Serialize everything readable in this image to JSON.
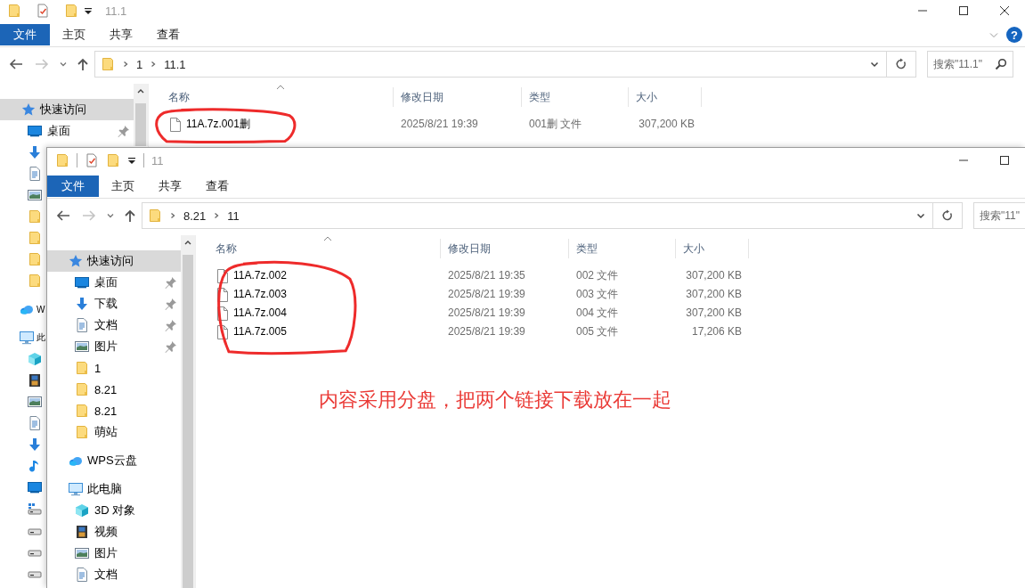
{
  "back_window": {
    "title": "11.1",
    "toolbar_separators": false,
    "ribbon": {
      "tabs": [
        {
          "label": "文件",
          "kind": "file"
        },
        {
          "label": "主页",
          "kind": "tab"
        },
        {
          "label": "共享",
          "kind": "tab"
        },
        {
          "label": "查看",
          "kind": "tab"
        }
      ],
      "help": "?"
    },
    "nav": {
      "back_disabled": false,
      "forward_disabled": true
    },
    "address": {
      "path": [
        "1",
        "11.1"
      ],
      "search_placeholder": "搜索\"11.1\""
    },
    "sidebar": [
      {
        "label": "快速访问",
        "selected": true,
        "children": [
          {
            "label": "桌面",
            "pinned": true,
            "selected": false
          },
          {
            "selected": false
          },
          {
            "selected": false
          },
          {
            "selected": false
          },
          {
            "selected": false
          },
          {
            "selected": false
          },
          {
            "selected": false
          },
          {
            "selected": false
          }
        ]
      },
      {
        "label": "W",
        "selected": false
      },
      {
        "label": "此",
        "selected": false,
        "children": [
          {
            "selected": false
          },
          {
            "selected": false
          },
          {
            "selected": false
          },
          {
            "selected": false
          },
          {
            "selected": false
          },
          {
            "selected": false
          },
          {
            "selected": false
          },
          {
            "selected": false
          },
          {
            "selected": false
          },
          {
            "selected": false
          },
          {
            "selected": false
          }
        ]
      }
    ],
    "columns": [
      "名称",
      "修改日期",
      "类型",
      "大小"
    ],
    "files": [
      {
        "name": "11A.7z.001删",
        "modified": "2025/8/21 19:39",
        "type": "001删 文件",
        "size": "307,200 KB"
      }
    ],
    "circled": true
  },
  "front_window": {
    "title": "11",
    "toolbar_separators": true,
    "ribbon": {
      "tabs": [
        {
          "label": "文件",
          "kind": "file"
        },
        {
          "label": "主页",
          "kind": "tab"
        },
        {
          "label": "共享",
          "kind": "tab"
        },
        {
          "label": "查看",
          "kind": "tab"
        }
      ]
    },
    "nav": {
      "back_disabled": false,
      "forward_disabled": true
    },
    "address": {
      "path": [
        "8.21",
        "11"
      ],
      "search_placeholder": "搜索\"11\""
    },
    "sidebar": [
      {
        "label": "快速访问",
        "selected": true,
        "children": [
          {
            "label": "桌面",
            "pinned": true,
            "selected": false
          },
          {
            "label": "下载",
            "pinned": true,
            "selected": false
          },
          {
            "label": "文档",
            "pinned": true,
            "selected": false
          },
          {
            "label": "图片",
            "pinned": true,
            "selected": false
          },
          {
            "label": "1",
            "pinned": false,
            "selected": false
          },
          {
            "label": "8.21",
            "pinned": false,
            "selected": false
          },
          {
            "label": "8.21",
            "pinned": false,
            "selected": false
          },
          {
            "label": "萌站",
            "pinned": false,
            "selected": false
          }
        ]
      },
      {
        "label": "WPS云盘",
        "selected": false
      },
      {
        "label": "此电脑",
        "selected": false,
        "children": [
          {
            "label": "3D 对象",
            "selected": false
          },
          {
            "label": "视频",
            "selected": false
          },
          {
            "label": "图片",
            "selected": false
          },
          {
            "label": "文档",
            "selected": false
          }
        ]
      }
    ],
    "columns": [
      "名称",
      "修改日期",
      "类型",
      "大小"
    ],
    "files": [
      {
        "name": "11A.7z.002",
        "modified": "2025/8/21 19:35",
        "type": "002 文件",
        "size": "307,200 KB"
      },
      {
        "name": "11A.7z.003",
        "modified": "2025/8/21 19:39",
        "type": "003 文件",
        "size": "307,200 KB"
      },
      {
        "name": "11A.7z.004",
        "modified": "2025/8/21 19:39",
        "type": "004 文件",
        "size": "307,200 KB"
      },
      {
        "name": "11A.7z.005",
        "modified": "2025/8/21 19:39",
        "type": "005 文件",
        "size": "17,206 KB"
      }
    ],
    "circled": true,
    "note": "内容采用分盘，把两个链接下载放在一起"
  }
}
